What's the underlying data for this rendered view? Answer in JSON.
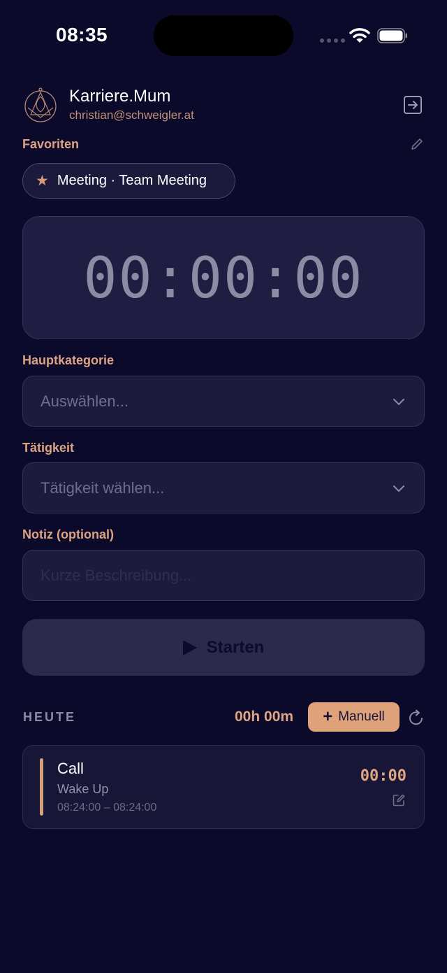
{
  "status_bar": {
    "time": "08:35"
  },
  "header": {
    "title": "Karriere.Mum",
    "email": "christian@schweigler.at"
  },
  "favorites": {
    "label": "Favoriten",
    "items": [
      {
        "text": "Meeting · Team Meeting"
      }
    ]
  },
  "timer": {
    "display": "00:00:00"
  },
  "main_category": {
    "label": "Hauptkategorie",
    "placeholder": "Auswählen..."
  },
  "activity": {
    "label": "Tätigkeit",
    "placeholder": "Tätigkeit wählen..."
  },
  "note": {
    "label": "Notiz (optional)",
    "placeholder": "Kurze Beschreibung..."
  },
  "start_button": {
    "label": "Starten"
  },
  "today": {
    "label": "HEUTE",
    "total": "00h 00m",
    "manual_button": "Manuell",
    "entries": [
      {
        "title": "Call",
        "subtitle": "Wake Up",
        "time_range": "08:24:00 – 08:24:00",
        "duration": "00:00"
      }
    ]
  },
  "colors": {
    "background": "#0b0a2a",
    "accent": "#dfa37c",
    "card": "#1f1e42"
  }
}
